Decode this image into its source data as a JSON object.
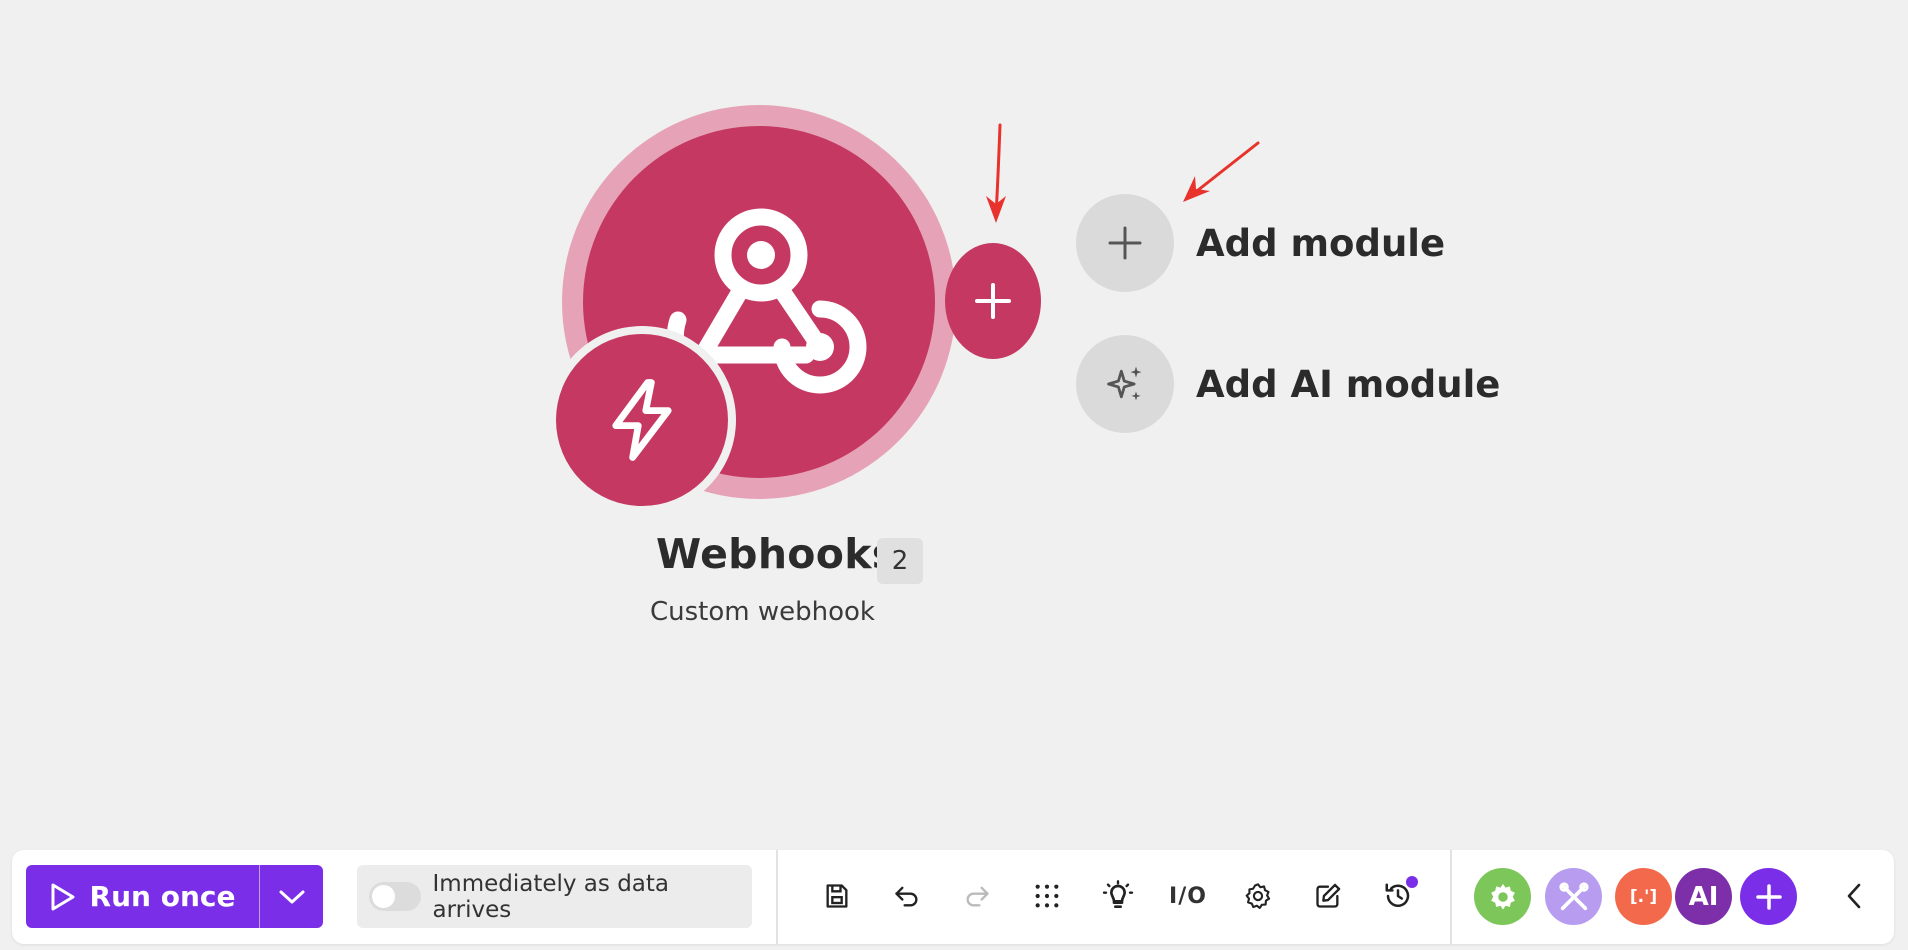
{
  "module": {
    "title": "Webhooks",
    "count": "2",
    "subtitle": "Custom webhook",
    "icon": "webhook-icon",
    "trigger_icon": "lightning-bolt-icon",
    "color": "#c53862"
  },
  "add_options": [
    {
      "label": "Add module",
      "icon": "plus-icon"
    },
    {
      "label": "Add AI module",
      "icon": "sparkles-icon"
    }
  ],
  "toolbar": {
    "run_label": "Run once",
    "run_icon": "play-icon",
    "run_menu_icon": "chevron-down-icon",
    "schedule_label": "Immediately as data arrives",
    "schedule_enabled": false,
    "tools": [
      {
        "name": "save-icon",
        "title": "Save"
      },
      {
        "name": "undo-icon",
        "title": "Undo"
      },
      {
        "name": "redo-icon",
        "title": "Redo",
        "disabled": true
      },
      {
        "name": "grid-icon",
        "title": "Auto-align"
      },
      {
        "name": "lightbulb-icon",
        "title": "Explain flow"
      },
      {
        "name": "io-icon",
        "title": "I/O",
        "text": "I/O"
      },
      {
        "name": "gear-icon",
        "title": "Scenario settings"
      },
      {
        "name": "notes-icon",
        "title": "Notes"
      },
      {
        "name": "history-icon",
        "title": "Previous versions"
      }
    ],
    "apps": [
      {
        "name": "tools-app",
        "color": "#7dc65a",
        "icon": "gear-icon"
      },
      {
        "name": "flow-control-app",
        "color": "#b79cf0",
        "icon": "cross-tools-icon"
      },
      {
        "name": "text-parser-app",
        "color": "#f26a4b",
        "icon": "brackets-icon",
        "text": "[.']"
      },
      {
        "name": "ai-app",
        "color": "#7c2fa8",
        "text": "AI"
      }
    ],
    "accent": "#7b2ee8"
  }
}
